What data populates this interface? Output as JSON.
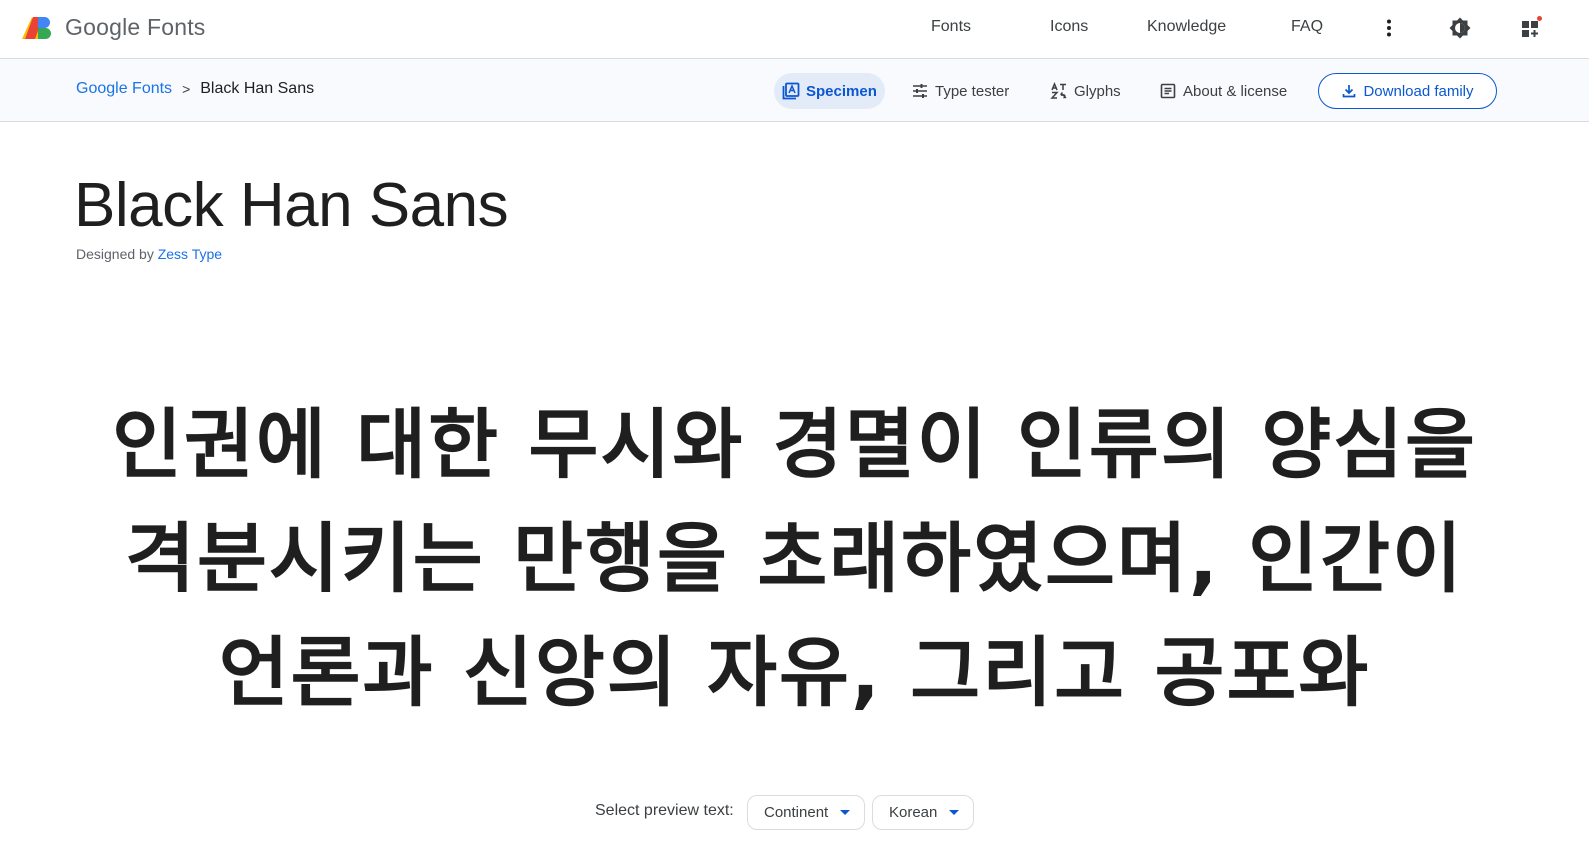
{
  "header": {
    "logo_text": "Google Fonts",
    "nav": [
      "Fonts",
      "Icons",
      "Knowledge",
      "FAQ"
    ],
    "icons": [
      "more-vert-icon",
      "theme-toggle-icon",
      "apps-grid-icon"
    ],
    "notification_dot_color": "#ea4335"
  },
  "subnav": {
    "breadcrumb": {
      "root": "Google Fonts",
      "separator": ">",
      "current": "Black Han Sans"
    },
    "tabs": {
      "specimen": "Specimen",
      "type_tester": "Type tester",
      "glyphs": "Glyphs",
      "about": "About & license"
    },
    "active_tab": "Specimen",
    "download_label": "Download family"
  },
  "font": {
    "name": "Black Han Sans",
    "designed_by_prefix": "Designed by",
    "designer": "Zess Type"
  },
  "preview": {
    "text": "인권에 대한 무시와 경멸이 인류의 양심을 격분시키는 만행을 초래하였으며, 인간이 언론과 신앙의 자유, 그리고 공포와"
  },
  "preview_select": {
    "label": "Select preview text:",
    "continent": "Continent",
    "language": "Korean"
  },
  "colors": {
    "accent": "#0b57d0",
    "link": "#1a73e8",
    "active_tab_bg": "#e3ebf9",
    "subbar_bg": "#f8fafd"
  }
}
